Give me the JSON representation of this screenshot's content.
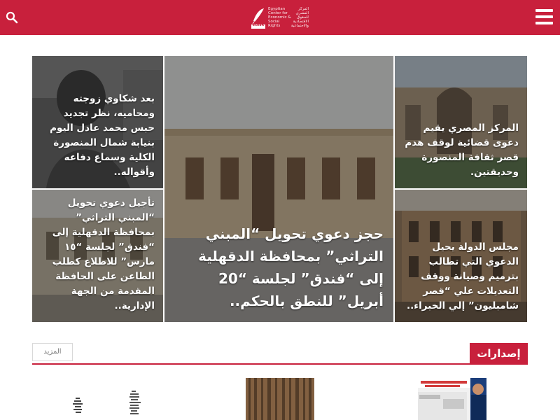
{
  "header": {
    "logo": {
      "alt_text": "ECESR",
      "lines": [
        "Egyptian",
        "Center for",
        "Economic &",
        "Social",
        "Rights"
      ],
      "lines_ar": [
        "المركز",
        "المصري",
        "للحقوق",
        "الاقتصادية",
        "والاجتماعية"
      ]
    },
    "menu_icon": "hamburger-menu-icon",
    "search_icon": "search-icon"
  },
  "featured": {
    "top_left": "بعد شكاوي زوجته ومحاميه، نظر تجديد حبس محمد عادل اليوم بنيابة شمال المنصورة الكلية وسماع دفاعه وأقواله..",
    "bottom_left": "تأجيل دعوي تحويل “المبني التراثي” بمحافظة الدقهلية إلى “فندق” لجلسة “١٥ مارس” للاطلاع كطلب الطاعن على الحافظة المقدمة من الجهة الإدارية..",
    "center": "حجز دعوي تحويل “المبني التراثي” بمحافظة الدقهلية إلى “فندق” لجلسة “20 أبريل” للنطق بالحكم..",
    "top_right": "المركز المصري يقيم دعوى قضائية لوقف هدم قصر ثقافة المنصورة وحديقتين.",
    "bottom_right": "مجلس الدولة يحيل الدعوي التي تطالب بترميم وصيانة ووقف التعديلات علي “قصر شامبليون” إلي الخبراء.."
  },
  "publications": {
    "title": "إصدارات",
    "more_label": "المزيد"
  },
  "colors": {
    "brand_red": "#c8203c",
    "white": "#ffffff"
  }
}
